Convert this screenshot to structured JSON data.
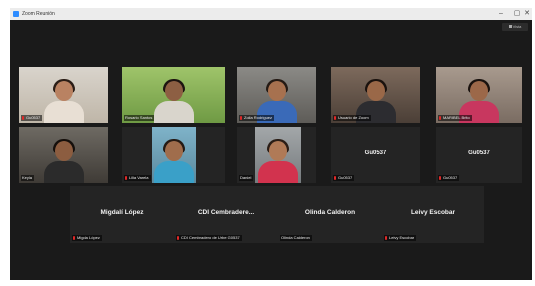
{
  "window": {
    "title": "Zoom Reunión",
    "min_glyph": "–",
    "max_glyph": "▢",
    "close_glyph": "✕"
  },
  "view": {
    "label": "Vista"
  },
  "colors": {
    "meeting_bg": "#1a1a1a",
    "tile_bg": "#242424",
    "active_speaker": "#a7e62b",
    "muted": "#e02828"
  },
  "tiles": [
    {
      "name": "Gu0537"
    },
    {
      "name": "Rosario Santos"
    },
    {
      "name": "Zoila Rodriguez"
    },
    {
      "name": "Usuario de Zoom"
    },
    {
      "name": "MARIBEL Brito"
    },
    {
      "name": "Keyla"
    },
    {
      "name": "Lilia Varela"
    },
    {
      "name": "Daniel"
    },
    {
      "display": "Gu0537",
      "name": "Gu0537"
    },
    {
      "display": "Gu0537",
      "name": "Gu0537"
    },
    {
      "display": "Migdalí López",
      "name": "Migda López"
    },
    {
      "display": "CDI Cembradere...",
      "name": "CDI Cembradero de Urbe G0537"
    },
    {
      "display": "Olinda Calderon",
      "name": "Olinda Calderon"
    },
    {
      "display": "Leivy Escobar",
      "name": "Leivy Escobar"
    }
  ]
}
